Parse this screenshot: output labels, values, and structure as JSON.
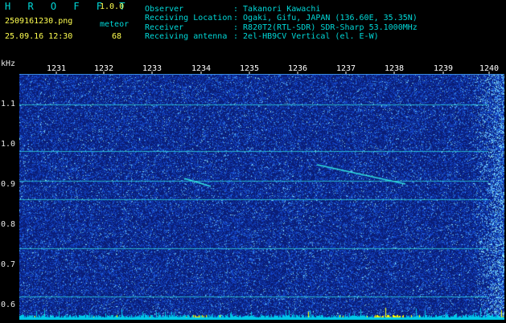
{
  "header": {
    "app_name": "H R O F F T",
    "version": "1.0.0",
    "filename": "2509161230.png",
    "category": "meteor",
    "datetime": "25.09.16 12:30",
    "count": "68",
    "info": [
      {
        "label": "Observer",
        "value": ": Takanori Kawachi"
      },
      {
        "label": "Receiving Location",
        "value": ": Ogaki, Gifu, JAPAN (136.60E, 35.35N)"
      },
      {
        "label": "Receiver",
        "value": ": R820T2(RTL-SDR) SDR-Sharp 53.1000MHz"
      },
      {
        "label": "Receiving antenna",
        "value": ": 2el-HB9CV Vertical (el. E-W)"
      }
    ]
  },
  "axis": {
    "y_unit": "kHz",
    "y_ticks": [
      "1.1",
      "1.0",
      "0.9",
      "0.8",
      "0.7",
      "0.6"
    ],
    "x_ticks": [
      "1231",
      "1232",
      "1233",
      "1234",
      "1235",
      "1236",
      "1237",
      "1238",
      "1239",
      "1240"
    ]
  },
  "colors": {
    "background": "#000000",
    "header_text": "#00d8d8",
    "header_value": "#ffff50",
    "spectrum_bg": "#0a2a8a",
    "noise": "#1c55d0",
    "signal": "#30e0e0",
    "bottom_band": "#00c8e8",
    "bottom_peaks": "#ffff00"
  }
}
